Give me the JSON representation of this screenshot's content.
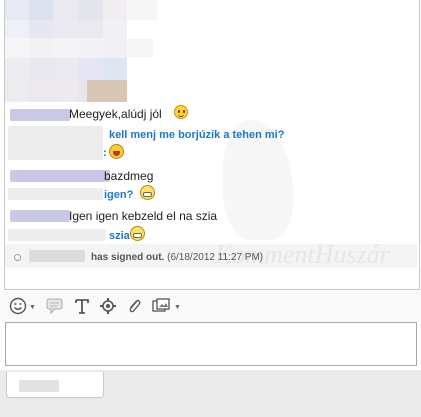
{
  "messages": [
    {
      "text": "Meegyek,alúdj jól",
      "style": "black",
      "emoticon": "smile-emoticon"
    },
    {
      "text": "kell menj me borjúzik a tehen mi?",
      "style": "blue"
    },
    {
      "text": ":",
      "style": "blue",
      "emoticon": "laugh-emoticon"
    },
    {
      "text": "bazdmeg",
      "style": "black"
    },
    {
      "text": "igen?",
      "style": "blue",
      "emoticon": "grin-emoticon"
    },
    {
      "text": "Igen igen kebzeld el na szia",
      "style": "black"
    },
    {
      "text": "szia",
      "style": "blue",
      "emoticon": "grin-emoticon"
    }
  ],
  "status": {
    "text": "has signed out.",
    "timestamp": "(6/18/2012 11:27 PM)"
  },
  "watermark": "KommentHuszár",
  "toolbar": {
    "icons": [
      "emoticon-icon",
      "speech-bubble-icon",
      "font-icon",
      "settings-icon",
      "attach-icon",
      "image-icon"
    ]
  },
  "input": {
    "value": ""
  },
  "colors": {
    "blue_text": "#1b78c7",
    "black_text": "#222222"
  }
}
